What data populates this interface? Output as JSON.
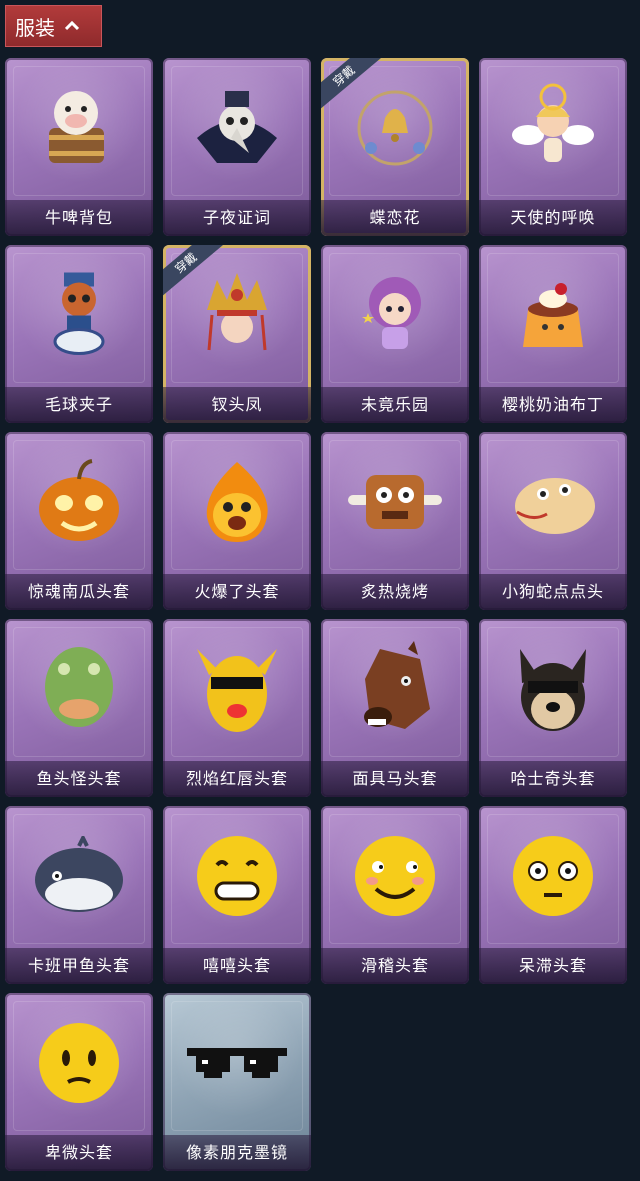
{
  "header": {
    "label": "服装"
  },
  "items": [
    {
      "name": "牛啤背包",
      "art": "cow-beer-backpack-icon",
      "equipped": false
    },
    {
      "name": "子夜证词",
      "art": "plague-doctor-icon",
      "equipped": false
    },
    {
      "name": "蝶恋花",
      "art": "bell-wreath-icon",
      "equipped": true
    },
    {
      "name": "天使的呼唤",
      "art": "angel-icon",
      "equipped": false
    },
    {
      "name": "毛球夹子",
      "art": "raccoon-drummer-icon",
      "equipped": false
    },
    {
      "name": "钗头凤",
      "art": "phoenix-crown-icon",
      "equipped": true
    },
    {
      "name": "未竟乐园",
      "art": "candy-girl-icon",
      "equipped": false
    },
    {
      "name": "樱桃奶油布丁",
      "art": "pudding-icon",
      "equipped": false
    },
    {
      "name": "惊魂南瓜头套",
      "art": "pumpkin-icon",
      "equipped": false
    },
    {
      "name": "火爆了头套",
      "art": "fire-head-icon",
      "equipped": false
    },
    {
      "name": "炙热烧烤",
      "art": "meat-head-icon",
      "equipped": false
    },
    {
      "name": "小狗蛇点点头",
      "art": "snake-head-icon",
      "equipped": false
    },
    {
      "name": "鱼头怪头套",
      "art": "fish-head-icon",
      "equipped": false
    },
    {
      "name": "烈焰红唇头套",
      "art": "yellow-mask-icon",
      "equipped": false
    },
    {
      "name": "面具马头套",
      "art": "horse-head-icon",
      "equipped": false
    },
    {
      "name": "哈士奇头套",
      "art": "husky-head-icon",
      "equipped": false
    },
    {
      "name": "卡班甲鱼头套",
      "art": "whale-head-icon",
      "equipped": false
    },
    {
      "name": "嘻嘻头套",
      "art": "grin-emoji-icon",
      "equipped": false
    },
    {
      "name": "滑稽头套",
      "art": "sly-emoji-icon",
      "equipped": false
    },
    {
      "name": "呆滞头套",
      "art": "stare-emoji-icon",
      "equipped": false
    },
    {
      "name": "卑微头套",
      "art": "humble-emoji-icon",
      "equipped": false
    },
    {
      "name": "像素朋克墨镜",
      "art": "pixel-sunglasses-icon",
      "equipped": false
    }
  ],
  "equipped_badge": "穿戴"
}
